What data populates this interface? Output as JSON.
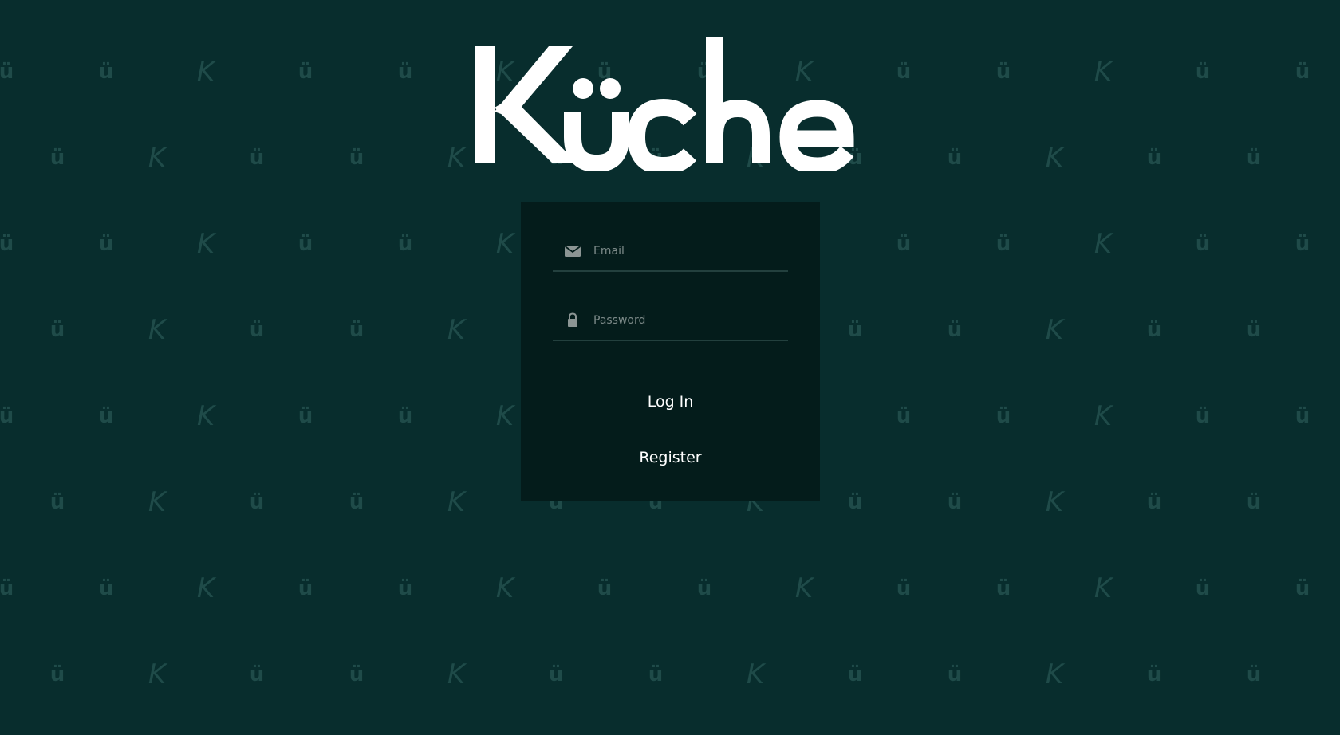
{
  "app": {
    "logo_text": "Küche",
    "logo_icon": "kuche-wordmark"
  },
  "background": {
    "pattern_glyphs": [
      "K",
      "ü"
    ]
  },
  "login_form": {
    "email": {
      "placeholder": "Email",
      "value": "",
      "icon": "envelope-icon"
    },
    "password": {
      "placeholder": "Password",
      "value": "",
      "icon": "lock-icon"
    },
    "login_label": "Log In",
    "register_label": "Register"
  },
  "colors": {
    "background": "#082d2d",
    "card": "#041c1b",
    "pattern": "#1f4b49",
    "text": "#ffffff",
    "placeholder": "#7d8a89"
  }
}
